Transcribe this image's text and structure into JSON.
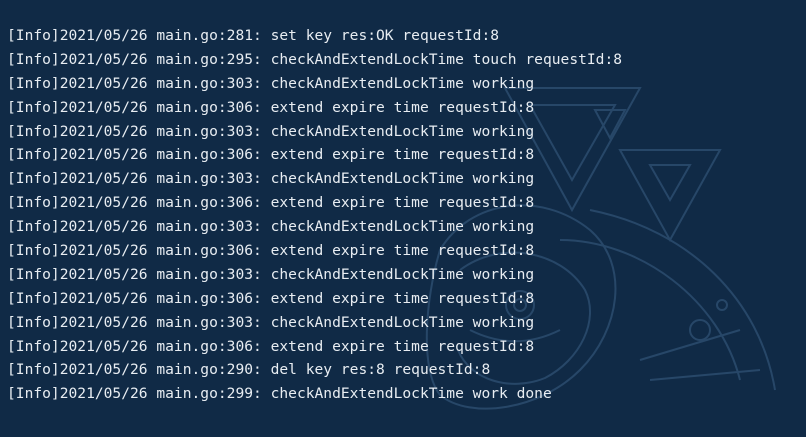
{
  "terminal": {
    "colors": {
      "background": "#102a46",
      "text": "#e8edf2",
      "art": "#3b5f85"
    },
    "lines": [
      "[Info]2021/05/26 main.go:281: set key res:OK requestId:8",
      "[Info]2021/05/26 main.go:295: checkAndExtendLockTime touch requestId:8",
      "[Info]2021/05/26 main.go:303: checkAndExtendLockTime working",
      "[Info]2021/05/26 main.go:306: extend expire time requestId:8",
      "[Info]2021/05/26 main.go:303: checkAndExtendLockTime working",
      "[Info]2021/05/26 main.go:306: extend expire time requestId:8",
      "[Info]2021/05/26 main.go:303: checkAndExtendLockTime working",
      "[Info]2021/05/26 main.go:306: extend expire time requestId:8",
      "[Info]2021/05/26 main.go:303: checkAndExtendLockTime working",
      "[Info]2021/05/26 main.go:306: extend expire time requestId:8",
      "[Info]2021/05/26 main.go:303: checkAndExtendLockTime working",
      "[Info]2021/05/26 main.go:306: extend expire time requestId:8",
      "[Info]2021/05/26 main.go:303: checkAndExtendLockTime working",
      "[Info]2021/05/26 main.go:306: extend expire time requestId:8",
      "[Info]2021/05/26 main.go:290: del key res:8 requestId:8",
      "[Info]2021/05/26 main.go:299: checkAndExtendLockTime work done"
    ]
  }
}
